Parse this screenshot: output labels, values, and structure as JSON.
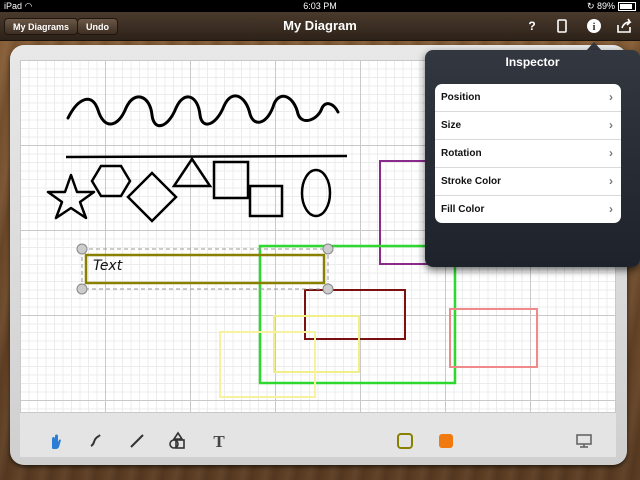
{
  "status": {
    "device": "iPad",
    "time": "6:03 PM",
    "battery": "89%"
  },
  "nav": {
    "back": "My Diagrams",
    "undo": "Undo",
    "title": "My Diagram",
    "help": "?"
  },
  "canvas": {
    "text_label": "Text"
  },
  "inspector": {
    "title": "Inspector",
    "items": [
      {
        "label": "Position"
      },
      {
        "label": "Size"
      },
      {
        "label": "Rotation"
      },
      {
        "label": "Stroke Color"
      },
      {
        "label": "Fill Color"
      }
    ]
  },
  "toolbar": {
    "tools": [
      "hand-tool",
      "freehand-tool",
      "line-tool",
      "shapes-tool",
      "text-tool"
    ],
    "stroke_color": "#8a8000",
    "fill_color": "#f07a10"
  },
  "colors": {
    "accent": "#2a7fd4"
  }
}
